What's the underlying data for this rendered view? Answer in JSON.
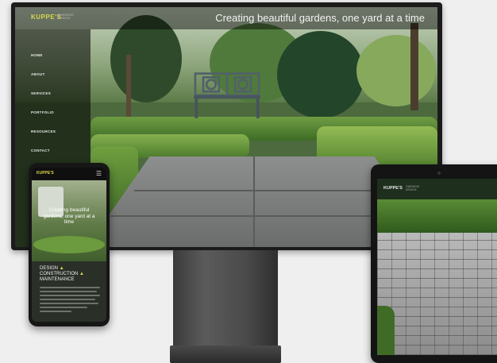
{
  "monitor": {
    "logo": "KUPPE'S",
    "logo_sub": "GARDENS DESIGN",
    "tagline": "Creating beautiful gardens, one yard at a time",
    "nav": [
      "HOME",
      "ABOUT",
      "SERVICES",
      "PORTFOLIO",
      "RESOURCES",
      "CONTACT"
    ]
  },
  "phone": {
    "logo": "KUPPE'S",
    "menu_icon": "hamburger-icon",
    "headline": "Creating beautiful gardens, one yard at a time",
    "services_line1": "DESIGN",
    "services_line2": "CONSTRUCTION",
    "services_line3": "MAINTENANCE",
    "accent": "▲"
  },
  "tablet": {
    "logo": "KUPPE'S",
    "logo_sub": "GARDENS DESIGN"
  },
  "colors": {
    "brand_yellow": "#d8d84c",
    "device_black": "#161616",
    "background": "#efefef"
  }
}
